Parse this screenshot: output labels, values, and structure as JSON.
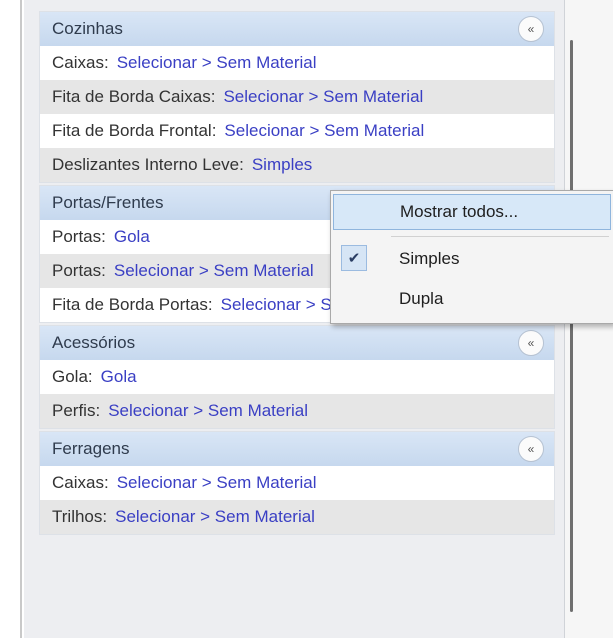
{
  "groups": [
    {
      "title": "Cozinhas",
      "rows": [
        {
          "label": "Caixas:",
          "value": "Selecionar > Sem Material"
        },
        {
          "label": "Fita de Borda Caixas:",
          "value": "Selecionar > Sem Material"
        },
        {
          "label": "Fita de Borda Frontal:",
          "value": "Selecionar > Sem Material"
        },
        {
          "label": "Deslizantes Interno Leve:",
          "value": "Simples"
        }
      ]
    },
    {
      "title": "Portas/Frentes",
      "rows": [
        {
          "label": "Portas:",
          "value": "Gola"
        },
        {
          "label": "Portas:",
          "value": "Selecionar > Sem Material"
        },
        {
          "label": "Fita de Borda Portas:",
          "value": "Selecionar > Sem Material"
        }
      ]
    },
    {
      "title": "Acessórios",
      "rows": [
        {
          "label": "Gola:",
          "value": "Gola"
        },
        {
          "label": "Perfis:",
          "value": "Selecionar > Sem Material"
        }
      ]
    },
    {
      "title": "Ferragens",
      "rows": [
        {
          "label": "Caixas:",
          "value": "Selecionar > Sem Material"
        },
        {
          "label": "Trilhos:",
          "value": "Selecionar > Sem Material"
        }
      ]
    }
  ],
  "collapse_glyph": "«",
  "context_menu": {
    "items": [
      {
        "label": "Mostrar todos...",
        "highlighted": true,
        "checked": false
      },
      {
        "label": "Simples",
        "highlighted": false,
        "checked": true
      },
      {
        "label": "Dupla",
        "highlighted": false,
        "checked": false
      }
    ],
    "check_glyph": "✔"
  }
}
